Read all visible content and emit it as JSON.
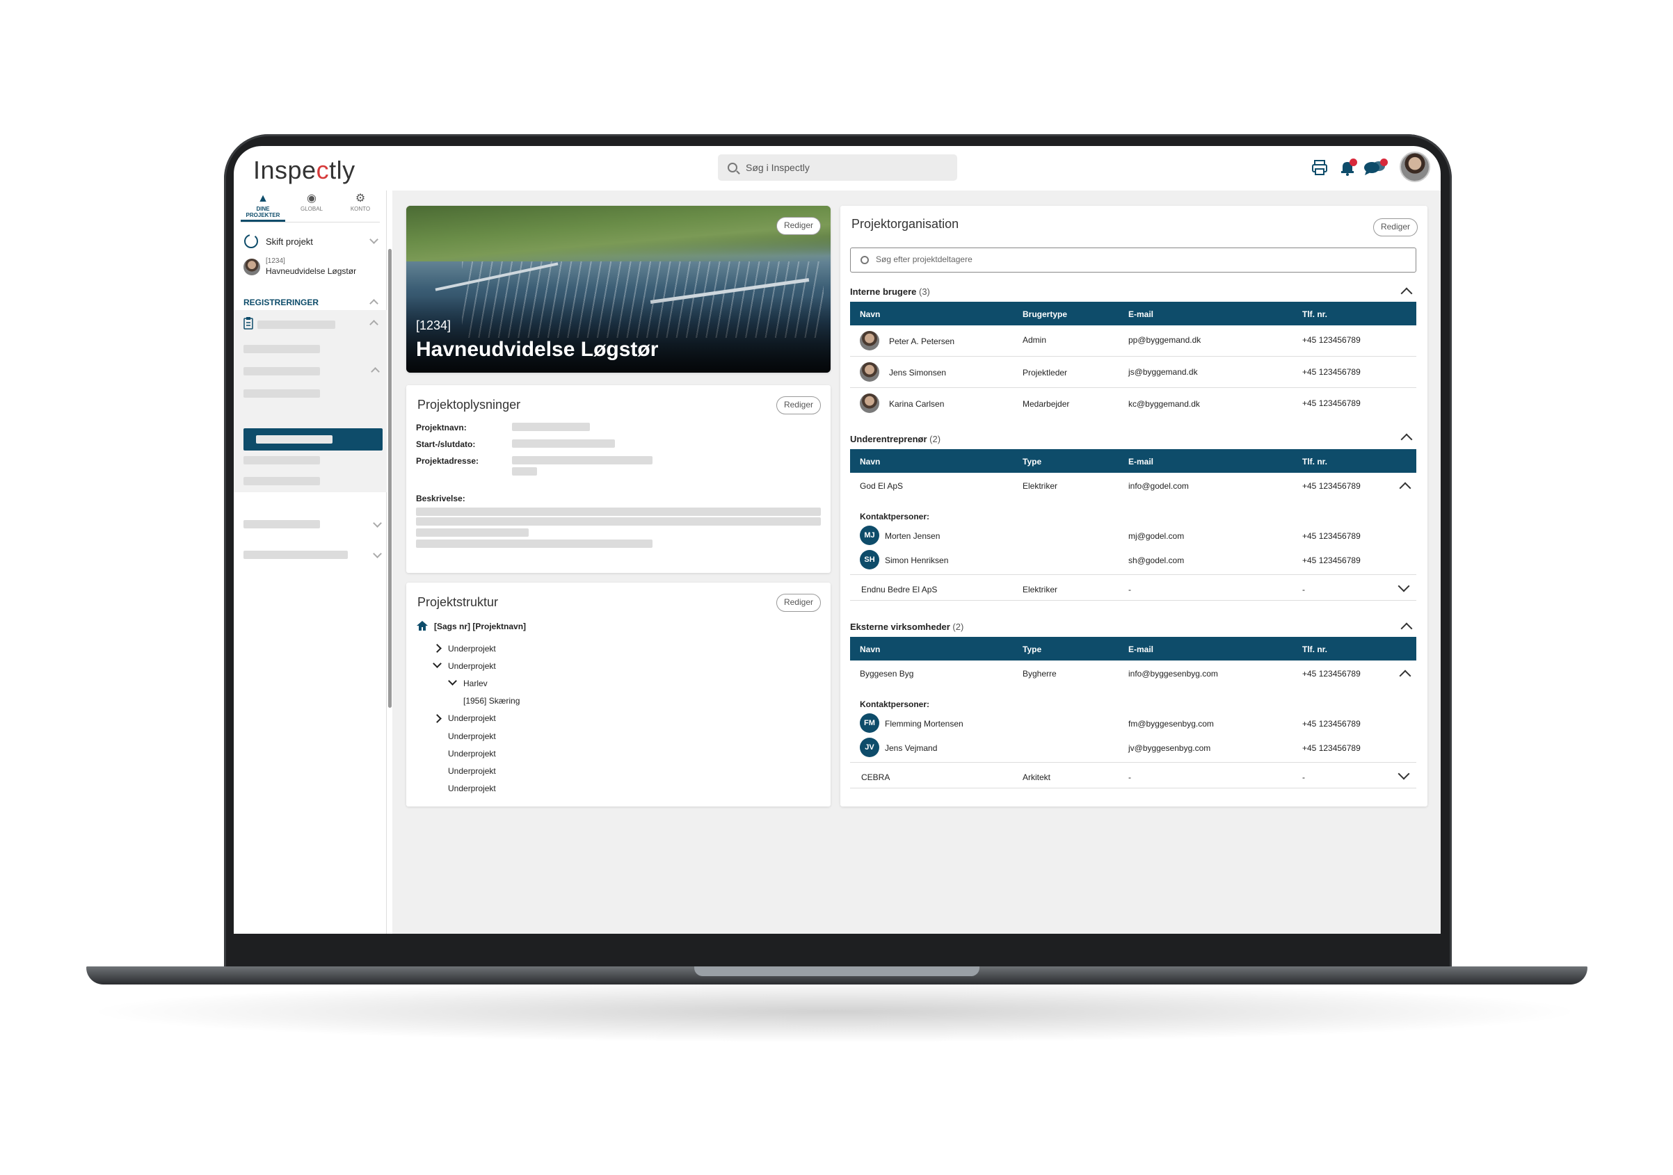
{
  "app": {
    "logo_pre": "Inspe",
    "logo_mid": "c",
    "logo_post": "tly",
    "search_placeholder": "Søg i Inspectly"
  },
  "sidebar": {
    "tabs": [
      {
        "label": "DINE PROJEKTER",
        "icon": "hard-hat-icon"
      },
      {
        "label": "GLOBAL",
        "icon": "globe-icon"
      },
      {
        "label": "KONTO",
        "icon": "gear-icon"
      }
    ],
    "switch_project": "Skift projekt",
    "project_code": "[1234]",
    "project_name": "Havneudvidelse Løgstør",
    "registrations": "REGISTRERINGER"
  },
  "hero": {
    "code": "[1234]",
    "title": "Havneudvidelse Løgstør",
    "edit": "Rediger"
  },
  "info": {
    "title": "Projektoplysninger",
    "edit": "Rediger",
    "fields": [
      "Projektnavn:",
      "Start-/slutdato:",
      "Projektadresse:"
    ],
    "description_label": "Beskrivelse:"
  },
  "structure": {
    "title": "Projektstruktur",
    "edit": "Rediger",
    "root": "[Sags nr] [Projektnavn]",
    "items": [
      "Underprojekt",
      "Underprojekt",
      "Harlev",
      "[1956] Skæring",
      "Underprojekt",
      "Underprojekt",
      "Underprojekt",
      "Underprojekt",
      "Underprojekt"
    ]
  },
  "org": {
    "title": "Projektorganisation",
    "edit": "Rediger",
    "search_placeholder": "Søg efter projektdeltagere",
    "internal": {
      "title": "Interne brugere",
      "count": "(3)",
      "headers": [
        "Navn",
        "Brugertype",
        "E-mail",
        "Tlf. nr."
      ],
      "rows": [
        {
          "name": "Peter A. Petersen",
          "type": "Admin",
          "email": "pp@byggemand.dk",
          "phone": "+45 123456789"
        },
        {
          "name": "Jens Simonsen",
          "type": "Projektleder",
          "email": "js@byggemand.dk",
          "phone": "+45 123456789"
        },
        {
          "name": "Karina Carlsen",
          "type": "Medarbejder",
          "email": "kc@byggemand.dk",
          "phone": "+45 123456789"
        }
      ]
    },
    "subcontractors": {
      "title": "Underentreprenør",
      "count": "(2)",
      "headers": [
        "Navn",
        "Type",
        "E-mail",
        "Tlf. nr."
      ],
      "company1": {
        "name": "God El ApS",
        "type": "Elektriker",
        "email": "info@godel.com",
        "phone": "+45 123456789"
      },
      "contacts_label": "Kontaktpersoner:",
      "contacts": [
        {
          "initials": "MJ",
          "name": "Morten Jensen",
          "email": "mj@godel.com",
          "phone": "+45 123456789"
        },
        {
          "initials": "SH",
          "name": "Simon Henriksen",
          "email": "sh@godel.com",
          "phone": "+45 123456789"
        }
      ],
      "company2": {
        "name": "Endnu Bedre El ApS",
        "type": "Elektriker",
        "email": "-",
        "phone": "-"
      }
    },
    "external": {
      "title": "Eksterne virksomheder",
      "count": "(2)",
      "headers": [
        "Navn",
        "Type",
        "E-mail",
        "Tlf. nr."
      ],
      "company1": {
        "name": "Byggesen Byg",
        "type": "Bygherre",
        "email": "info@byggesenbyg.com",
        "phone": "+45 123456789"
      },
      "contacts_label": "Kontaktpersoner:",
      "contacts": [
        {
          "initials": "FM",
          "name": "Flemming Mortensen",
          "email": "fm@byggesenbyg.com",
          "phone": "+45 123456789"
        },
        {
          "initials": "JV",
          "name": "Jens Vejmand",
          "email": "jv@byggesenbyg.com",
          "phone": "+45 123456789"
        }
      ],
      "company2": {
        "name": "CEBRA",
        "type": "Arkitekt",
        "email": "-",
        "phone": "-"
      }
    }
  },
  "colors": {
    "primary": "#0e4c6a",
    "accent": "#d8293b"
  }
}
